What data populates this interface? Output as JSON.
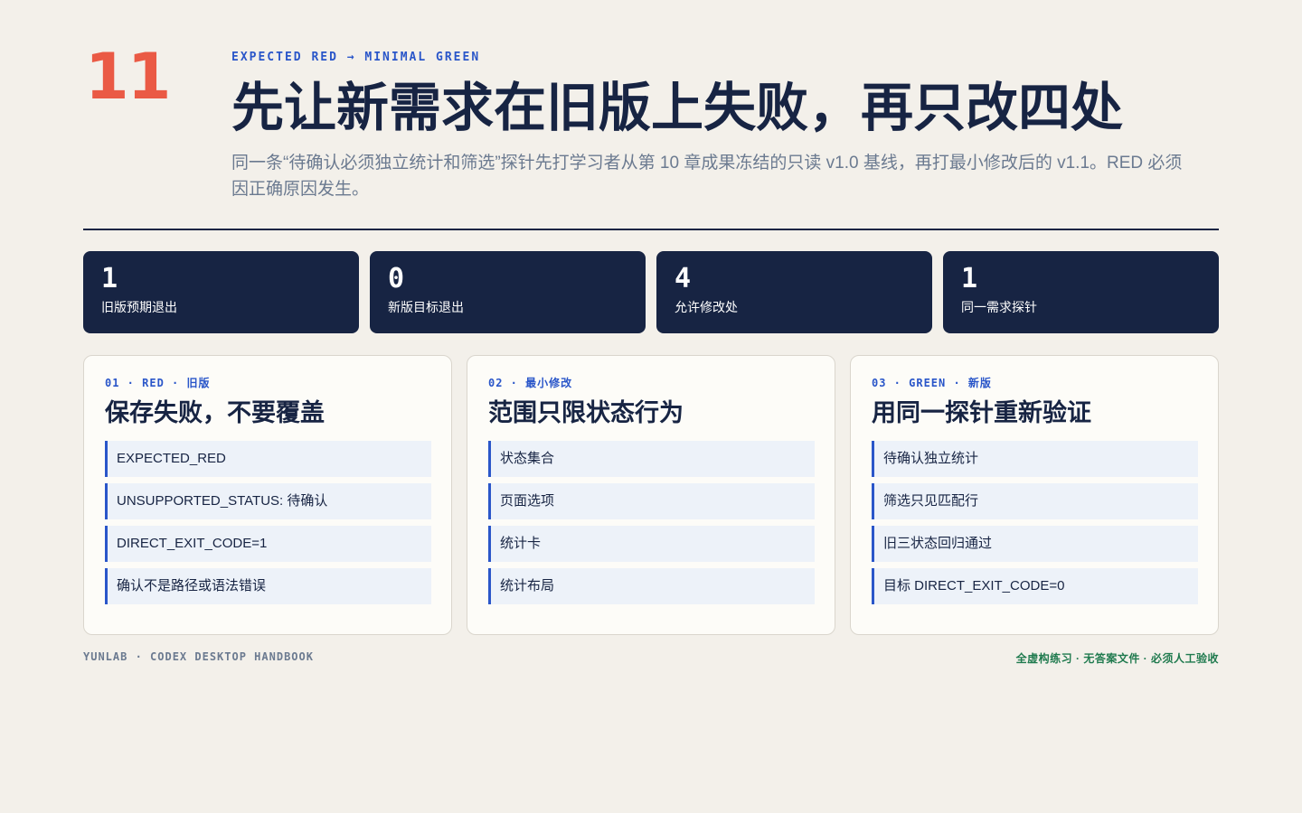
{
  "chapter": {
    "number": "11"
  },
  "header": {
    "eyebrow": "EXPECTED RED → MINIMAL GREEN",
    "title": "先让新需求在旧版上失败，再只改四处",
    "subtitle": "同一条“待确认必须独立统计和筛选”探针先打学习者从第 10 章成果冻结的只读 v1.0 基线，再打最小修改后的 v1.1。RED 必须因正确原因发生。"
  },
  "stats": [
    {
      "value": "1",
      "label": "旧版预期退出"
    },
    {
      "value": "0",
      "label": "新版目标退出"
    },
    {
      "value": "4",
      "label": "允许修改处"
    },
    {
      "value": "1",
      "label": "同一需求探针"
    }
  ],
  "cards": [
    {
      "tag": "01 · RED · 旧版",
      "title": "保存失败，不要覆盖",
      "items": [
        "EXPECTED_RED",
        "UNSUPPORTED_STATUS: 待确认",
        "DIRECT_EXIT_CODE=1",
        "确认不是路径或语法错误"
      ]
    },
    {
      "tag": "02 · 最小修改",
      "title": "范围只限状态行为",
      "items": [
        "状态集合",
        "页面选项",
        "统计卡",
        "统计布局"
      ]
    },
    {
      "tag": "03 · GREEN · 新版",
      "title": "用同一探针重新验证",
      "items": [
        "待确认独立统计",
        "筛选只见匹配行",
        "旧三状态回归通过",
        "目标 DIRECT_EXIT_CODE=0"
      ]
    }
  ],
  "footer": {
    "left": "YUNLAB · CODEX DESKTOP HANDBOOK",
    "right": "全虚构练习 · 无答案文件 · 必须人工验收"
  }
}
